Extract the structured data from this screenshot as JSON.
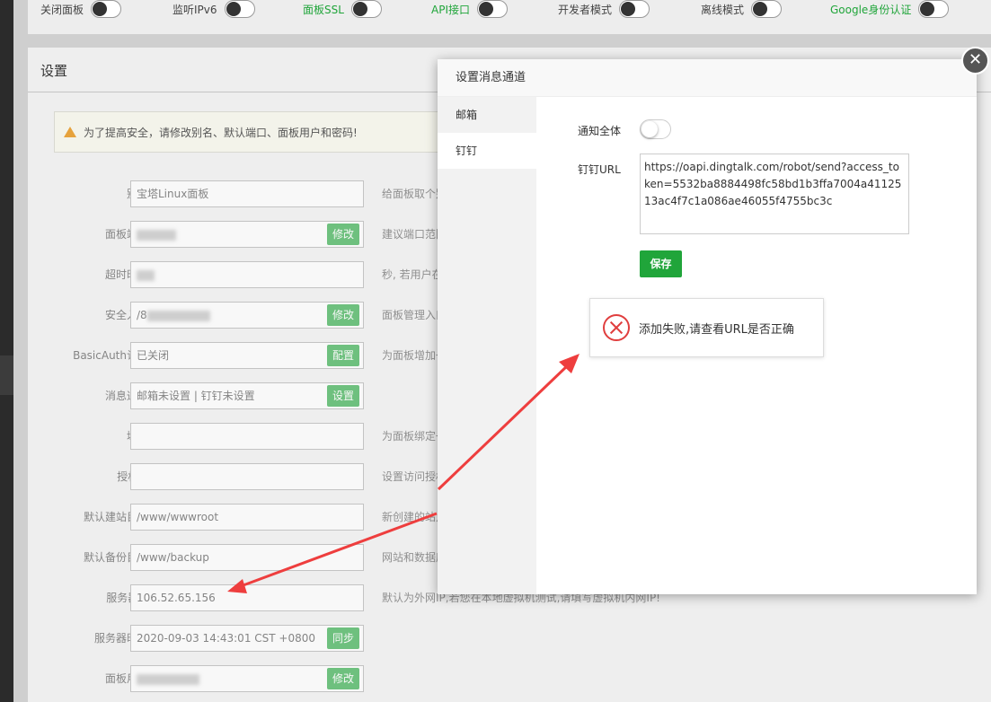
{
  "top_toggles": [
    {
      "label": "关闭面板",
      "green": false
    },
    {
      "label": "监听IPv6",
      "green": false
    },
    {
      "label": "面板SSL",
      "green": true
    },
    {
      "label": "API接口",
      "green": true
    },
    {
      "label": "开发者模式",
      "green": false
    },
    {
      "label": "离线模式",
      "green": false
    },
    {
      "label": "Google身份认证",
      "green": true
    }
  ],
  "settings": {
    "title": "设置",
    "warning": "为了提高安全，请修改别名、默认端口、面板用户和密码!",
    "rows": [
      {
        "label": "别名",
        "value": "宝塔Linux面板",
        "button": "",
        "hint": "给面板取个别名"
      },
      {
        "label": "面板端口",
        "value": "",
        "button": "修改",
        "hint": "建议端口范围"
      },
      {
        "label": "超时时间",
        "value": "",
        "button": "",
        "hint": "秒, 若用户在"
      },
      {
        "label": "安全入口",
        "value": "/8",
        "button": "修改",
        "hint": "面板管理入口"
      },
      {
        "label": "BasicAuth认证",
        "value": "已关闭",
        "button": "配置",
        "hint": "为面板增加一"
      },
      {
        "label": "消息通道",
        "value": "邮箱未设置 | 钉钉未设置",
        "button": "设置",
        "hint": ""
      },
      {
        "label": "域名",
        "value": "",
        "button": "",
        "hint": "为面板绑定一"
      },
      {
        "label": "授权IP",
        "value": "",
        "button": "",
        "hint": "设置访问授权"
      },
      {
        "label": "默认建站目录",
        "value": "/www/wwwroot",
        "button": "",
        "hint": "新创建的站点"
      },
      {
        "label": "默认备份目录",
        "value": "/www/backup",
        "button": "",
        "hint": "网站和数据库"
      },
      {
        "label": "服务器IP",
        "value": "106.52.65.156",
        "button": "",
        "hint": "默认为外网IP,若您在本地虚拟机测试,请填写虚拟机内网IP!"
      },
      {
        "label": "服务器时间",
        "value": "2020-09-03 14:43:01 CST +0800",
        "button": "同步",
        "hint": ""
      },
      {
        "label": "面板用户",
        "value": "",
        "button": "修改",
        "hint": ""
      }
    ]
  },
  "modal": {
    "title": "设置消息通道",
    "close_glyph": "✕",
    "tabs": [
      {
        "label": "邮箱",
        "active": false
      },
      {
        "label": "钉钉",
        "active": true
      }
    ],
    "notify_all_label": "通知全体",
    "url_label": "钉钉URL",
    "url_value": "https://oapi.dingtalk.com/robot/send?access_token=5532ba8884498fc58bd1b3ffa7004a4112513ac4f7c1a086ae46055f4755bc3c",
    "save_label": "保存",
    "toast_message": "添加失败,请查看URL是否正确"
  },
  "colors": {
    "accent": "#20a53a",
    "error": "#e03e3e",
    "arrow": "#ee3e3e"
  }
}
